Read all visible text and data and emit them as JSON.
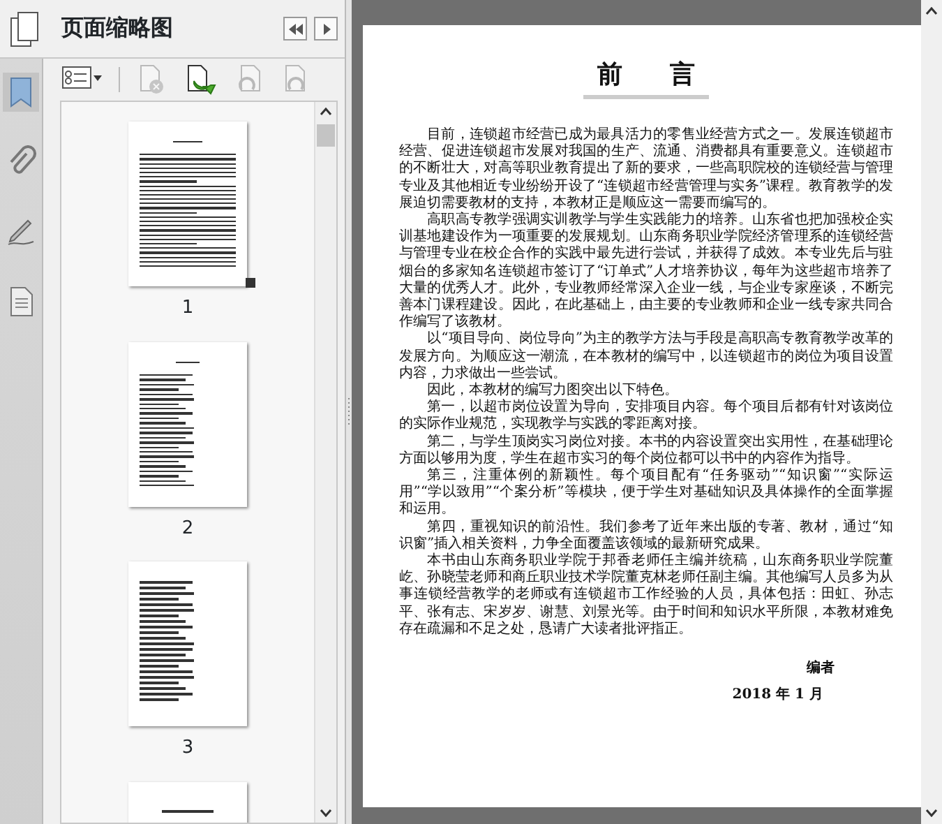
{
  "side_panel": {
    "title": "页面缩略图",
    "rail": [
      {
        "kind": "bookmark",
        "selected": true
      },
      {
        "kind": "attachment",
        "selected": false
      },
      {
        "kind": "signature",
        "selected": false
      },
      {
        "kind": "document",
        "selected": false
      }
    ],
    "toolbar": [
      {
        "kind": "options",
        "disabled": false
      },
      {
        "kind": "delete",
        "disabled": true
      },
      {
        "kind": "insert",
        "disabled": false
      },
      {
        "kind": "undo",
        "disabled": true
      },
      {
        "kind": "redo",
        "disabled": true
      }
    ],
    "thumbnails": [
      {
        "label": "1",
        "selected": true,
        "kind": "text"
      },
      {
        "label": "2",
        "selected": false,
        "kind": "contents"
      },
      {
        "label": "3",
        "selected": false,
        "kind": "contents-short"
      },
      {
        "selected": false,
        "kind": "chapter"
      }
    ]
  },
  "document": {
    "title": "前 言",
    "paragraphs": [
      "目前，连锁超市经营已成为最具活力的零售业经营方式之一。发展连锁超市经营、促进连锁超市发展对我国的生产、流通、消费都具有重要意义。连锁超市的不断壮大，对高等职业教育提出了新的要求，一些高职院校的连锁经营与管理专业及其他相近专业纷纷开设了“连锁超市经营管理与实务”课程。教育教学的发展迫切需要教材的支持，本教材正是顺应这一需要而编写的。",
      "高职高专教学强调实训教学与学生实践能力的培养。山东省也把加强校企实训基地建设作为一项重要的发展规划。山东商务职业学院经济管理系的连锁经营与管理专业在校企合作的实践中最先进行尝试，并获得了成效。本专业先后与驻烟台的多家知名连锁超市签订了“订单式”人才培养协议，每年为这些超市培养了大量的优秀人才。此外，专业教师经常深入企业一线，与企业专家座谈，不断完善本门课程建设。因此，在此基础上，由主要的专业教师和企业一线专家共同合作编写了该教材。",
      "以“项目导向、岗位导向”为主的教学方法与手段是高职高专教育教学改革的发展方向。为顺应这一潮流，在本教材的编写中，以连锁超市的岗位为项目设置内容，力求做出一些尝试。",
      "因此，本教材的编写力图突出以下特色。",
      "第一，以超市岗位设置为导向，安排项目内容。每个项目后都有针对该岗位的实际作业规范，实现教学与实践的零距离对接。",
      "第二，与学生顶岗实习岗位对接。本书的内容设置突出实用性，在基础理论方面以够用为度，学生在超市实习的每个岗位都可以书中的内容作为指导。",
      "第三，注重体例的新颖性。每个项目配有“任务驱动”“知识窗”“实际运用”“学以致用”“个案分析”等模块，便于学生对基础知识及具体操作的全面掌握和运用。",
      "第四，重视知识的前沿性。我们参考了近年来出版的专著、教材，通过“知识窗”插入相关资料，力争全面覆盖该领域的最新研究成果。",
      "本书由山东商务职业学院于邦香老师任主编并统稿，山东商务职业学院董屹、孙晓莹老师和商丘职业技术学院董克林老师任副主编。其他编写人员多为从事连锁经营教学的老师或有连锁超市工作经验的人员，具体包括：田虹、孙志平、张有志、宋岁岁、谢慧、刘景光等。由于时间和知识水平所限，本教材难免存在疏漏和不足之处，恳请广大读者批评指正。"
    ],
    "signature": "编者",
    "date": "2018 年 1 月"
  }
}
